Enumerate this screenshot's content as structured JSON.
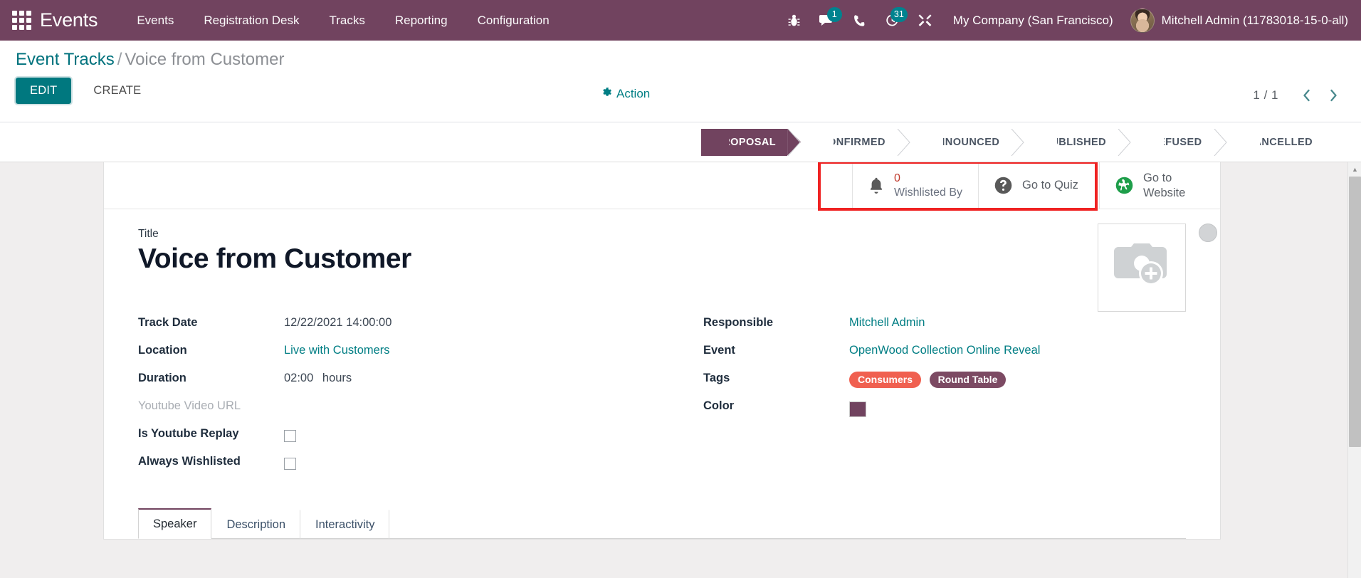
{
  "navbar": {
    "apps_icon": "apps-grid-icon",
    "brand": "Events",
    "menus": [
      "Events",
      "Registration Desk",
      "Tracks",
      "Reporting",
      "Configuration"
    ],
    "sys_icons": [
      {
        "name": "bug-icon",
        "badge": null
      },
      {
        "name": "messages-icon",
        "badge": "1"
      },
      {
        "name": "phone-icon",
        "badge": null
      },
      {
        "name": "activity-clock-icon",
        "badge": "31"
      },
      {
        "name": "tools-icon",
        "badge": null
      }
    ],
    "company": "My Company (San Francisco)",
    "user": "Mitchell Admin (11783018-15-0-all)",
    "bg_color": "#71435f"
  },
  "control_panel": {
    "breadcrumb_root": "Event Tracks",
    "breadcrumb_sep": "/",
    "breadcrumb_current": "Voice from Customer",
    "edit_label": "EDIT",
    "create_label": "CREATE",
    "action_label": "Action",
    "action_icon": "gear-icon",
    "pager_count": "1 / 1",
    "prev_icon": "chevron-left-icon",
    "next_icon": "chevron-right-icon"
  },
  "statusbar": {
    "stages": [
      "PROPOSAL",
      "CONFIRMED",
      "ANNOUNCED",
      "PUBLISHED",
      "REFUSED",
      "CANCELLED"
    ],
    "active": "PROPOSAL",
    "active_color": "#71435f"
  },
  "stat_buttons": [
    {
      "icon": "bell-icon",
      "value": "0",
      "label": "Wishlisted By",
      "value_color": "#c0392b"
    },
    {
      "icon": "question-circle-icon",
      "label": "Go to Quiz"
    },
    {
      "icon": "globe-icon",
      "label_line1": "Go to",
      "label_line2": "Website"
    }
  ],
  "highlight": {
    "color": "#ef2222"
  },
  "record": {
    "title_label": "Title",
    "title_value": "Voice from Customer",
    "image_placeholder_icon": "camera-add-icon",
    "avatar_icon": "avatar-circle-icon",
    "left_fields": [
      {
        "label": "Track Date",
        "value": "12/22/2021 14:00:00",
        "type": "text"
      },
      {
        "label": "Location",
        "value": "Live with Customers",
        "type": "link"
      },
      {
        "label": "Duration",
        "value": "02:00",
        "suffix": "hours",
        "type": "text"
      },
      {
        "label": "Youtube Video URL",
        "value": "",
        "type": "empty"
      },
      {
        "label": "Is Youtube Replay",
        "value": "",
        "type": "checkbox",
        "checked": false
      },
      {
        "label": "Always Wishlisted",
        "value": "",
        "type": "checkbox",
        "checked": false
      }
    ],
    "right_fields": [
      {
        "label": "Responsible",
        "value": "Mitchell Admin",
        "type": "link"
      },
      {
        "label": "Event",
        "value": "OpenWood Collection Online Reveal",
        "type": "link"
      },
      {
        "label": "Tags",
        "type": "tags",
        "tags": [
          {
            "text": "Consumers",
            "color": "#f06050"
          },
          {
            "text": "Round Table",
            "color": "#7c4a63"
          }
        ]
      },
      {
        "label": "Color",
        "type": "color",
        "color": "#71435f"
      }
    ],
    "tabs": [
      {
        "label": "Speaker",
        "active": true
      },
      {
        "label": "Description",
        "active": false
      },
      {
        "label": "Interactivity",
        "active": false
      }
    ]
  }
}
